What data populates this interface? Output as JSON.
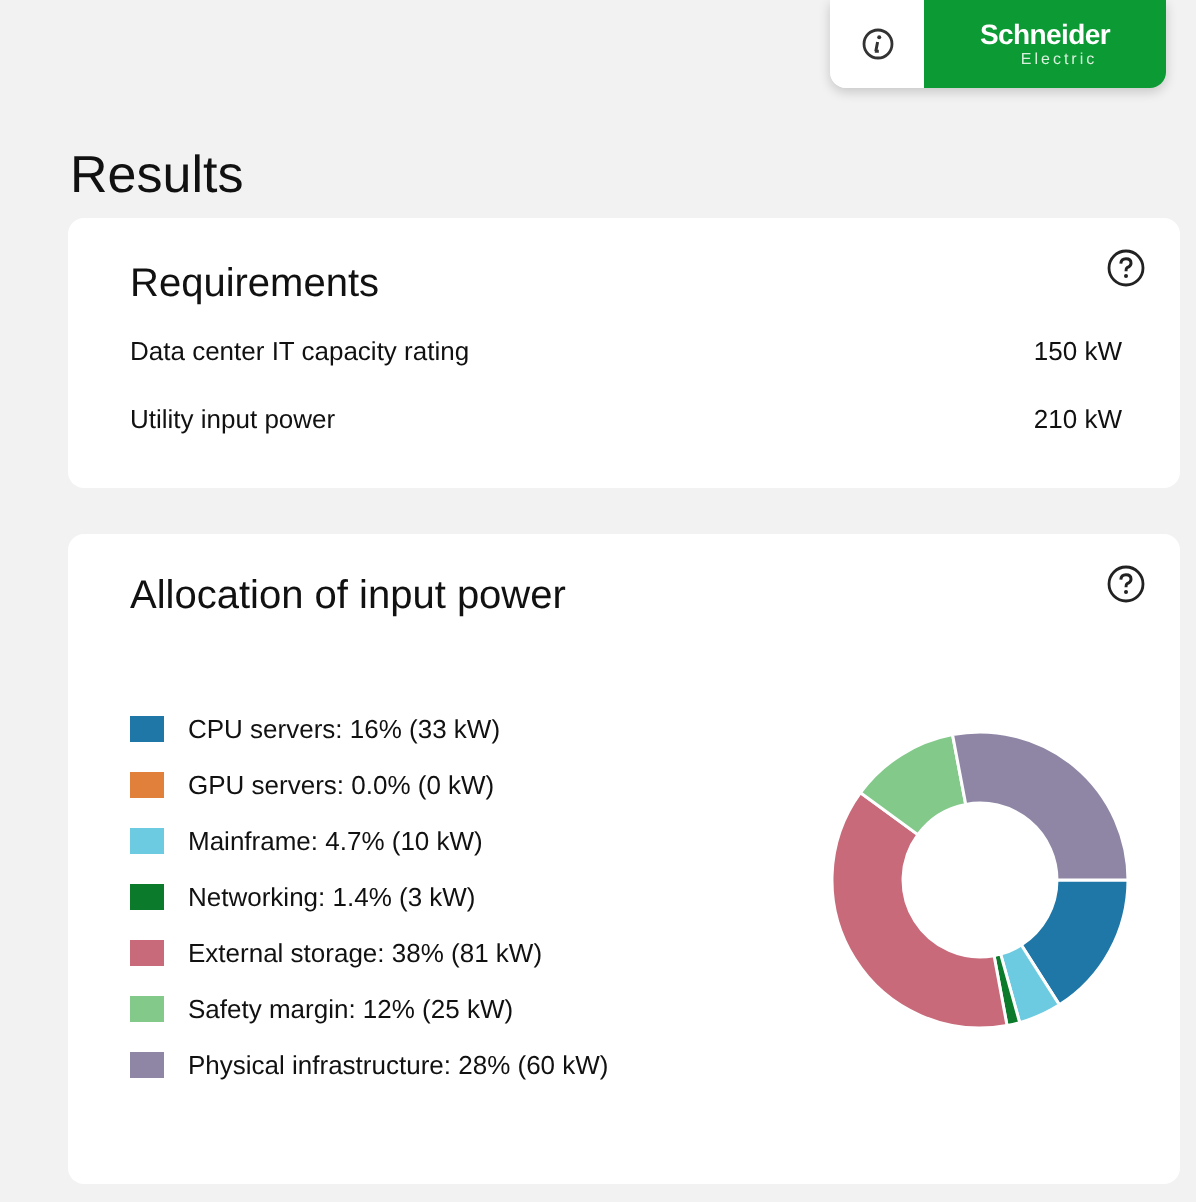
{
  "header": {
    "brand_line_1": "Schneider",
    "brand_line_2": "Electric"
  },
  "page_title": "Results",
  "requirements": {
    "title": "Requirements",
    "rows": [
      {
        "label": "Data center IT capacity rating",
        "value": "150 kW"
      },
      {
        "label": "Utility input power",
        "value": "210 kW"
      }
    ]
  },
  "allocation": {
    "title": "Allocation of input power",
    "legend": [
      {
        "label": "CPU servers: 16% (33 kW)",
        "color": "#1f77a8"
      },
      {
        "label": "GPU servers: 0.0% (0 kW)",
        "color": "#e0803a"
      },
      {
        "label": "Mainframe: 4.7% (10 kW)",
        "color": "#6ccbe0"
      },
      {
        "label": "Networking: 1.4% (3 kW)",
        "color": "#0b7a2a"
      },
      {
        "label": "External storage: 38% (81 kW)",
        "color": "#c86a7a"
      },
      {
        "label": "Safety margin: 12% (25 kW)",
        "color": "#82c98a"
      },
      {
        "label": "Physical infrastructure: 28% (60 kW)",
        "color": "#8f86a6"
      }
    ],
    "chart_data": {
      "type": "donut",
      "values": [
        16,
        0,
        4.7,
        1.4,
        38,
        12,
        28
      ]
    }
  }
}
